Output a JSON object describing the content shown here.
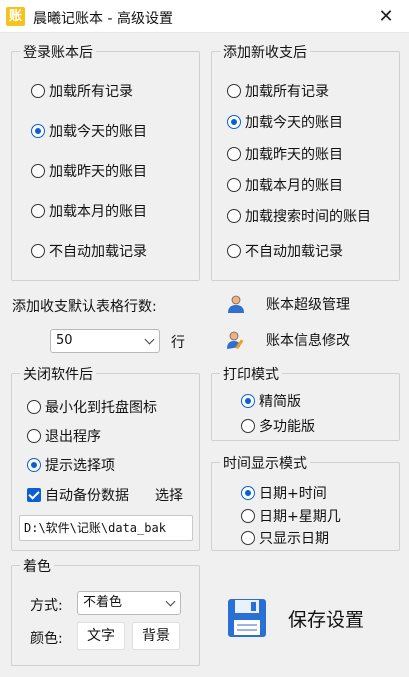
{
  "window": {
    "title": "晨曦记账本 - 高级设置",
    "app_icon_char": "账",
    "close_symbol": "✕"
  },
  "login_group": {
    "title": "登录账本后",
    "options": [
      "加载所有记录",
      "加载今天的账目",
      "加载昨天的账目",
      "加载本月的账目",
      "不自动加载记录"
    ],
    "selected_index": 1
  },
  "add_group": {
    "title": "添加新收支后",
    "options": [
      "加载所有记录",
      "加载今天的账目",
      "加载昨天的账目",
      "加载本月的账目",
      "加载搜索时间的账目",
      "不自动加载记录"
    ],
    "selected_index": 1
  },
  "rows_setting": {
    "label": "添加收支默认表格行数:",
    "value": "50",
    "unit": "行"
  },
  "links": {
    "super_manage": "账本超级管理",
    "info_edit": "账本信息修改"
  },
  "close_group": {
    "title": "关闭软件后",
    "options": [
      "最小化到托盘图标",
      "退出程序",
      "提示选择项"
    ],
    "selected_index": 2,
    "auto_backup_label": "自动备份数据",
    "auto_backup_checked": true,
    "choose_label": "选择",
    "backup_path": "D:\\软件\\记账\\data_bak"
  },
  "print_group": {
    "title": "打印模式",
    "options": [
      "精简版",
      "多功能版"
    ],
    "selected_index": 0
  },
  "time_group": {
    "title": "时间显示模式",
    "options": [
      "日期+时间",
      "日期+星期几",
      "只显示日期"
    ],
    "selected_index": 0
  },
  "color_group": {
    "title": "着色",
    "mode_label": "方式:",
    "mode_value": "不着色",
    "color_label": "颜色:",
    "text_btn": "文字",
    "bg_btn": "背景"
  },
  "save_button": {
    "label": "保存设置"
  },
  "colors": {
    "accent": "#0a5fd6",
    "background": "#f0f0f0"
  }
}
